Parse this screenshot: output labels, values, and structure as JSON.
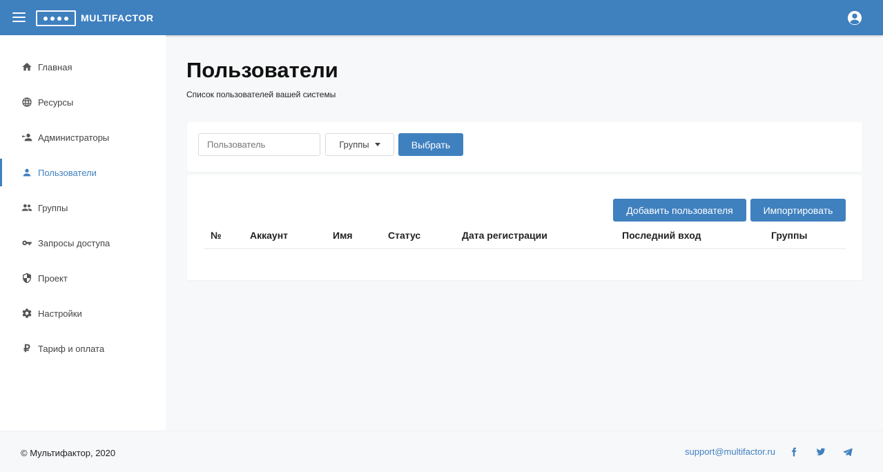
{
  "header": {
    "brand": "MULTIFACTOR"
  },
  "sidebar": {
    "items": [
      {
        "label": "Главная",
        "icon": "home-icon",
        "active": false
      },
      {
        "label": "Ресурсы",
        "icon": "globe-icon",
        "active": false
      },
      {
        "label": "Администраторы",
        "icon": "admin-icon",
        "active": false
      },
      {
        "label": "Пользователи",
        "icon": "person-icon",
        "active": true
      },
      {
        "label": "Группы",
        "icon": "people-icon",
        "active": false
      },
      {
        "label": "Запросы доступа",
        "icon": "key-icon",
        "active": false
      },
      {
        "label": "Проект",
        "icon": "shield-icon",
        "active": false
      },
      {
        "label": "Настройки",
        "icon": "gear-icon",
        "active": false
      },
      {
        "label": "Тариф и оплата",
        "icon": "ruble-icon",
        "active": false
      }
    ]
  },
  "main": {
    "title": "Пользователи",
    "subtitle": "Список пользователей вашей системы"
  },
  "filter": {
    "user_placeholder": "Пользователь",
    "groups_label": "Группы",
    "select_label": "Выбрать"
  },
  "table": {
    "add_user_label": "Добавить пользователя",
    "import_label": "Импортировать",
    "columns": [
      "№",
      "Аккаунт",
      "Имя",
      "Статус",
      "Дата регистрации",
      "Последний вход",
      "Группы"
    ],
    "rows": []
  },
  "footer": {
    "copyright": "© Мультифактор, 2020",
    "support_email": "support@multifactor.ru",
    "social": [
      "facebook-icon",
      "twitter-icon",
      "telegram-icon"
    ]
  },
  "colors": {
    "accent": "#3f80bf",
    "background": "#f7f8fa"
  }
}
